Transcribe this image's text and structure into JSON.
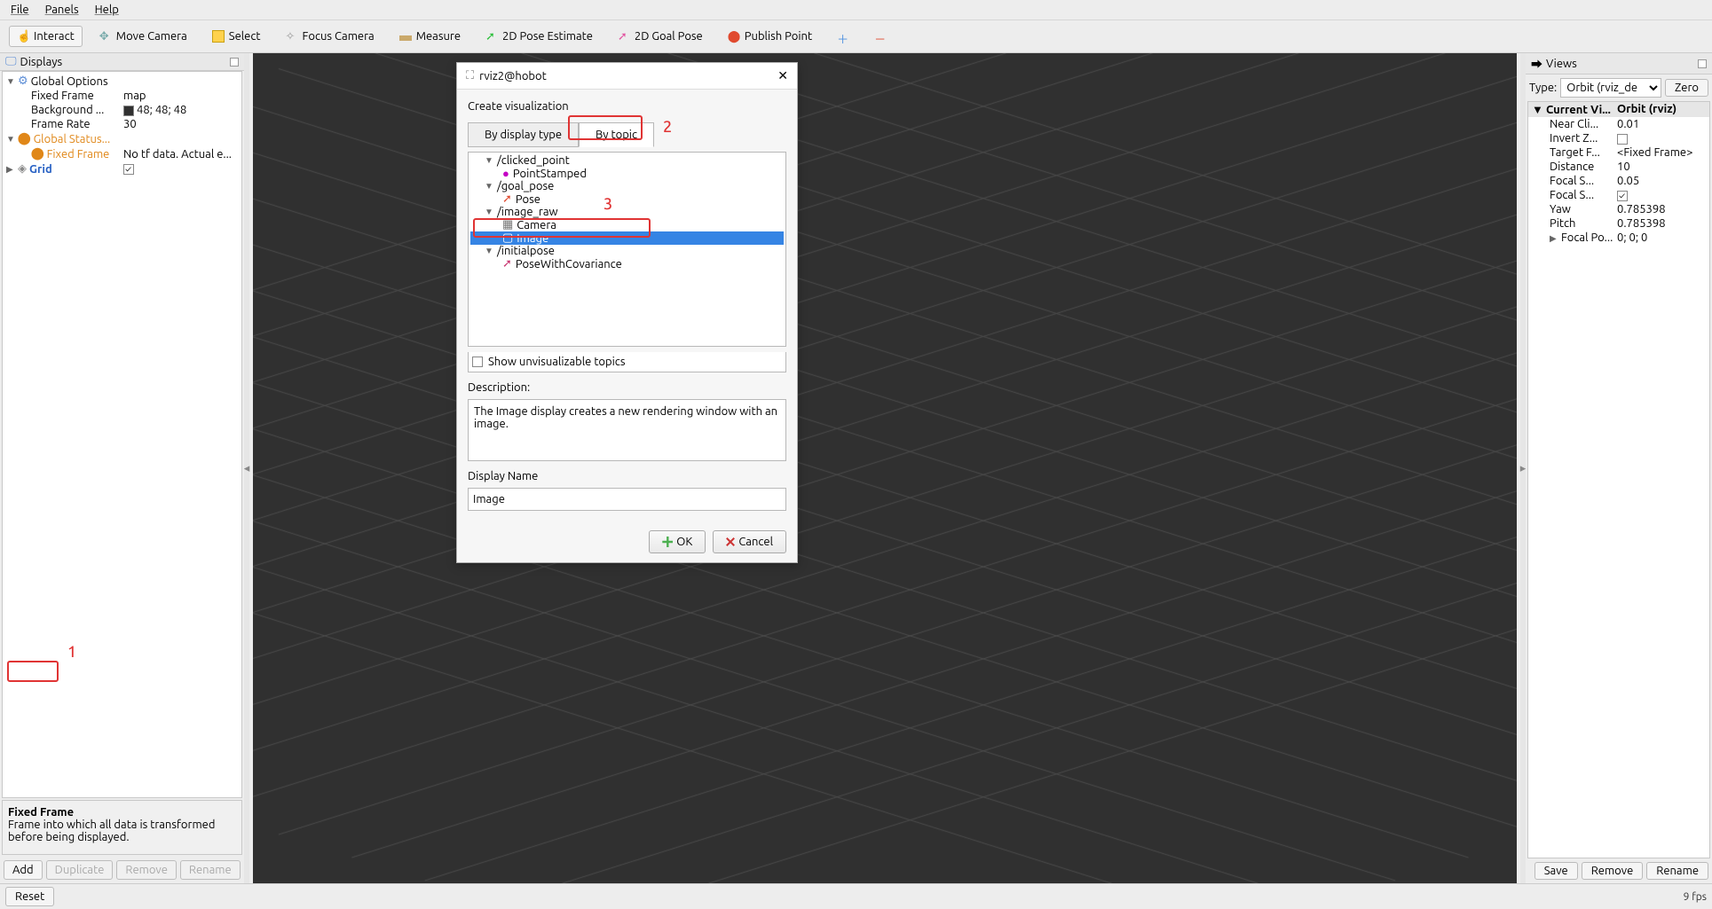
{
  "menubar": {
    "file": "File",
    "panels": "Panels",
    "help": "Help"
  },
  "toolbar": {
    "interact": "Interact",
    "move_camera": "Move Camera",
    "select": "Select",
    "focus_camera": "Focus Camera",
    "measure": "Measure",
    "pose_estimate": "2D Pose Estimate",
    "goal_pose": "2D Goal Pose",
    "publish_point": "Publish Point"
  },
  "displays": {
    "title": "Displays",
    "global_options": "Global Options",
    "fixed_frame_label": "Fixed Frame",
    "fixed_frame_value": "map",
    "background_label": "Background ...",
    "background_value": "48; 48; 48",
    "frame_rate_label": "Frame Rate",
    "frame_rate_value": "30",
    "global_status": "Global Status...",
    "status_fixed_frame": "Fixed Frame",
    "status_fixed_value": "No tf data.  Actual e...",
    "grid": "Grid",
    "help_title": "Fixed Frame",
    "help_text": "Frame into which all data is transformed before being displayed.",
    "add": "Add",
    "duplicate": "Duplicate",
    "remove": "Remove",
    "rename": "Rename"
  },
  "dialog": {
    "title": "rviz2@hobot",
    "heading": "Create visualization",
    "tab_display_type": "By display type",
    "tab_topic": "By topic",
    "topics": {
      "clicked_point": "/clicked_point",
      "point_stamped": "PointStamped",
      "goal_pose": "/goal_pose",
      "pose": "Pose",
      "image_raw": "/image_raw",
      "camera": "Camera",
      "image": "Image",
      "initialpose": "/initialpose",
      "pose_cov": "PoseWithCovariance"
    },
    "show_unvis": "Show unvisualizable topics",
    "description_label": "Description:",
    "description_text": "The Image display creates a new rendering window with an image.",
    "display_name_label": "Display Name",
    "display_name_value": "Image",
    "ok": "OK",
    "cancel": "Cancel"
  },
  "views": {
    "title": "Views",
    "type_label": "Type:",
    "type_value": "Orbit (rviz_de",
    "zero": "Zero",
    "header_l": "Current Vi...",
    "header_r": "Orbit (rviz)",
    "rows": [
      {
        "l": "Near Cli...",
        "r": "0.01"
      },
      {
        "l": "Invert Z...",
        "r": "",
        "chk": true
      },
      {
        "l": "Target F...",
        "r": "<Fixed Frame>"
      },
      {
        "l": "Distance",
        "r": "10"
      },
      {
        "l": "Focal S...",
        "r": "0.05"
      },
      {
        "l": "Focal S...",
        "r": "",
        "chk": true,
        "checked": true
      },
      {
        "l": "Yaw",
        "r": "0.785398"
      },
      {
        "l": "Pitch",
        "r": "0.785398"
      },
      {
        "l": "Focal Po...",
        "r": "0; 0; 0",
        "expandable": true
      }
    ],
    "save": "Save",
    "remove": "Remove",
    "rename": "Rename"
  },
  "footer": {
    "reset": "Reset",
    "fps": "9 fps"
  },
  "annotations": {
    "n1": "1",
    "n2": "2",
    "n3": "3"
  }
}
